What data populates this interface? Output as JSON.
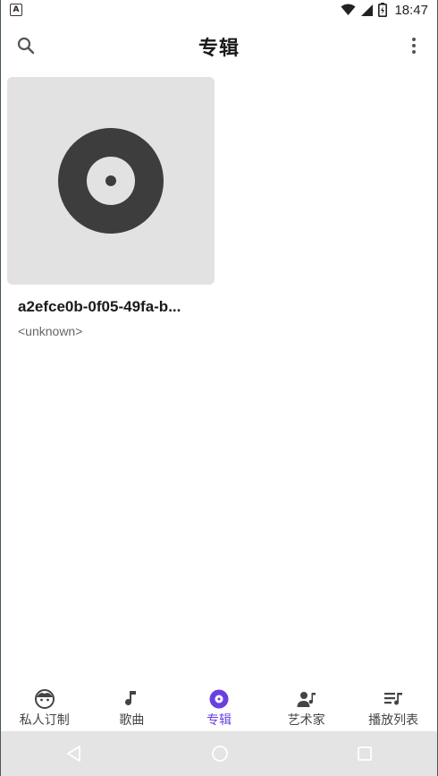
{
  "status_bar": {
    "app_icon_letter": "A",
    "time": "18:47"
  },
  "app_bar": {
    "title": "专辑",
    "icons": {
      "left": "search-icon",
      "right": "more-vert-icon"
    }
  },
  "albums": [
    {
      "title": "a2efce0b-0f05-49fa-b...",
      "artist": "<unknown>",
      "cover_icon": "vinyl-disc-icon"
    }
  ],
  "bottom_nav": {
    "items": [
      {
        "label": "私人订制",
        "icon": "face-icon",
        "active": false
      },
      {
        "label": "歌曲",
        "icon": "music-note-icon",
        "active": false
      },
      {
        "label": "专辑",
        "icon": "album-icon",
        "active": true
      },
      {
        "label": "艺术家",
        "icon": "artist-icon",
        "active": false
      },
      {
        "label": "播放列表",
        "icon": "playlist-icon",
        "active": false
      }
    ]
  },
  "colors": {
    "accent": "#6a3fe0",
    "cover_bg": "#e2e2e2",
    "disc": "#3d3d3d",
    "sys_nav_bg": "#e4e4e4"
  }
}
